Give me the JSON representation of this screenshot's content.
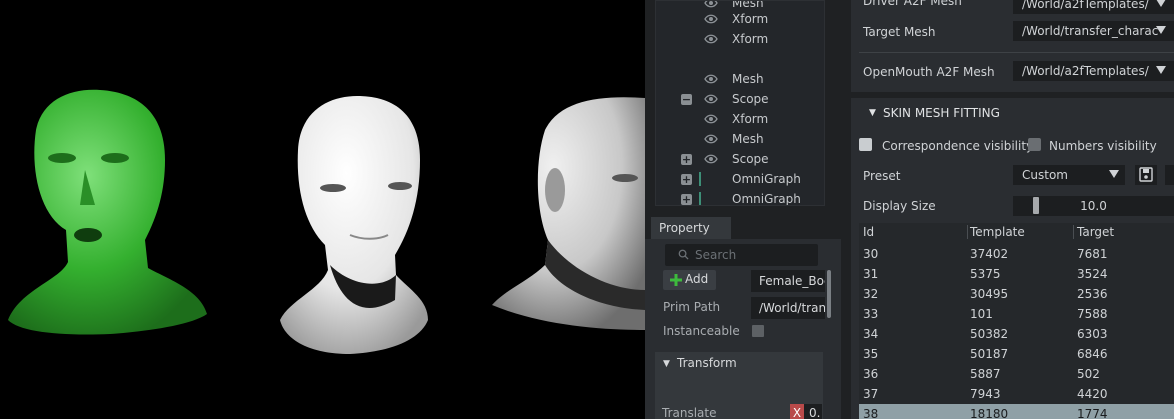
{
  "stage": {
    "rows": [
      {
        "label": "Mesh",
        "eye": true,
        "toggle": ""
      },
      {
        "label": "Xform",
        "eye": true,
        "toggle": ""
      },
      {
        "label": "Xform",
        "eye": true,
        "toggle": ""
      },
      {
        "label": "",
        "eye": false,
        "toggle": ""
      },
      {
        "label": "Mesh",
        "eye": true,
        "toggle": ""
      },
      {
        "label": "Scope",
        "eye": true,
        "toggle": "−"
      },
      {
        "label": "Xform",
        "eye": true,
        "toggle": ""
      },
      {
        "label": "Mesh",
        "eye": true,
        "toggle": ""
      },
      {
        "label": "Scope",
        "eye": true,
        "toggle": "+"
      },
      {
        "label": "OmniGraph",
        "eye": false,
        "toggle": "+"
      },
      {
        "label": "OmniGraph",
        "eye": false,
        "toggle": "+"
      }
    ]
  },
  "property": {
    "tab_label": "Property",
    "search_placeholder": "Search",
    "add_label": "Add",
    "name_value": "Female_Boc",
    "prim_path_label": "Prim Path",
    "prim_path_value": "/World/tran",
    "instanceable_label": "Instanceable",
    "transform_label": "Transform",
    "translate_label": "Translate",
    "x_label": "X",
    "x_value": "0."
  },
  "meshes": {
    "driver_label": "Driver A2F Mesh",
    "driver_value": "/World/a2fTemplates/",
    "target_label": "Target Mesh",
    "target_value": "/World/transfer_charac",
    "openmouth_label": "OpenMouth A2F Mesh",
    "openmouth_value": "/World/a2fTemplates/"
  },
  "skin": {
    "title": "SKIN MESH FITTING",
    "correspondence_label": "Correspondence visibility",
    "numbers_label": "Numbers visibility",
    "preset_label": "Preset",
    "preset_value": "Custom",
    "display_size_label": "Display Size",
    "display_size_value": "10.0",
    "display_size_fraction": 0.13,
    "columns": [
      "Id",
      "Template",
      "Target"
    ],
    "rows": [
      [
        "30",
        "37402",
        "7681"
      ],
      [
        "31",
        "5375",
        "3524"
      ],
      [
        "32",
        "30495",
        "2536"
      ],
      [
        "33",
        "101",
        "7588"
      ],
      [
        "34",
        "50382",
        "6303"
      ],
      [
        "35",
        "50187",
        "6846"
      ],
      [
        "36",
        "5887",
        "502"
      ],
      [
        "37",
        "7943",
        "4420"
      ],
      [
        "38",
        "18180",
        "1774"
      ]
    ],
    "selected_row": 8
  },
  "colors": {
    "accent_green": "#3dbb3d",
    "selection": "#8fa0a6",
    "x_axis": "#b94a4a"
  }
}
